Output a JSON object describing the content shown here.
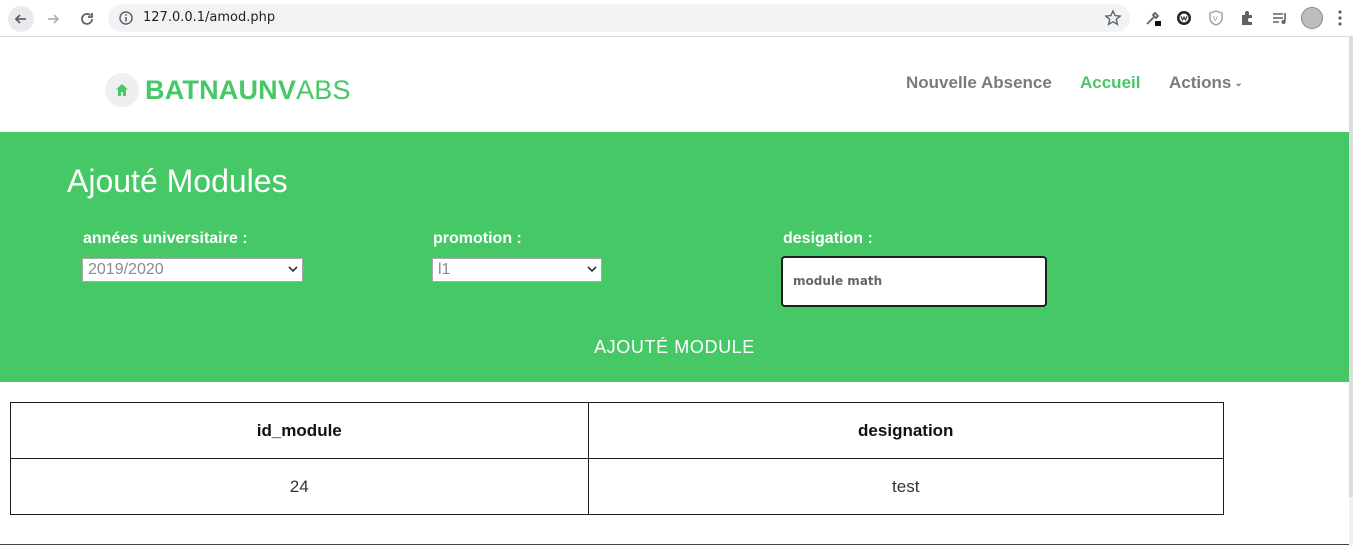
{
  "browser": {
    "url": "127.0.0.1/amod.php"
  },
  "navbar": {
    "brand_bold": "BATNAUNV",
    "brand_light": "ABS",
    "items": [
      {
        "label": "Nouvelle Absence"
      },
      {
        "label": "Accueil"
      },
      {
        "label": "Actions"
      }
    ],
    "active_color": "#45c865"
  },
  "form": {
    "title": "Ajouté Modules",
    "year_label": "années universitaire :",
    "year_value": "2019/2020",
    "promotion_label": "promotion :",
    "promotion_value": "l1",
    "designation_label": "desigation :",
    "designation_value": "module math",
    "submit_label": "AJOUTÉ MODULE",
    "background_color": "#45c865"
  },
  "table": {
    "headers": [
      "id_module",
      "designation"
    ],
    "rows": [
      [
        "24",
        "test"
      ]
    ]
  }
}
